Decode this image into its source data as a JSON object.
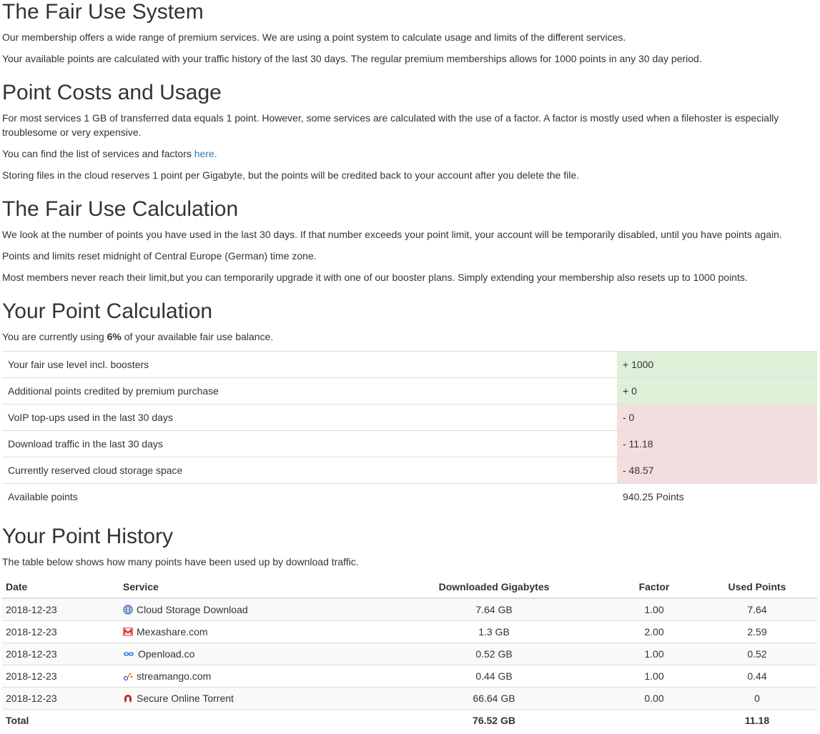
{
  "fair_use": {
    "title": "The Fair Use System",
    "p1": "Our membership offers a wide range of premium services. We are using a point system to calculate usage and limits of the different services.",
    "p2": "Your available points are calculated with your traffic history of the last 30 days. The regular premium memberships allows for 1000 points in any 30 day period."
  },
  "point_costs": {
    "title": "Point Costs and Usage",
    "p1": "For most services 1 GB of transferred data equals 1 point. However, some services are calculated with the use of a factor. A factor is mostly used when a filehoster is especially troublesome or very expensive.",
    "p2_prefix": "You can find the list of services and factors ",
    "p2_link": "here.",
    "p3": "Storing files in the cloud reserves 1 point per Gigabyte, but the points will be credited back to your account after you delete the file."
  },
  "calculation": {
    "title": "The Fair Use Calculation",
    "p1": "We look at the number of points you have used in the last 30 days. If that number exceeds your point limit, your account will be temporarily disabled, until you have points again.",
    "p2": "Points and limits reset midnight of Central Europe (German) time zone.",
    "p3": "Most members never reach their limit,but you can temporarily upgrade it with one of our booster plans. Simply extending your membership also resets up to 1000 points."
  },
  "your_calc": {
    "title": "Your Point Calculation",
    "usage_prefix": "You are currently using ",
    "usage_percent": "6%",
    "usage_suffix": " of your available fair use balance.",
    "rows": [
      {
        "label": "Your fair use level incl. boosters",
        "value": "+ 1000",
        "type": "pos"
      },
      {
        "label": "Additional points credited by premium purchase",
        "value": "+ 0",
        "type": "pos"
      },
      {
        "label": "VoIP top-ups used in the last 30 days",
        "value": "- 0",
        "type": "neg"
      },
      {
        "label": "Download traffic in the last 30 days",
        "value": "- 11.18",
        "type": "neg"
      },
      {
        "label": "Currently reserved cloud storage space",
        "value": "- 48.57",
        "type": "neg"
      },
      {
        "label": "Available points",
        "value": "940.25 Points",
        "type": "plain"
      }
    ]
  },
  "history": {
    "title": "Your Point History",
    "description": "The table below shows how many points have been used up by download traffic.",
    "headers": {
      "date": "Date",
      "service": "Service",
      "downloaded": "Downloaded Gigabytes",
      "factor": "Factor",
      "used": "Used Points"
    },
    "rows": [
      {
        "date": "2018-12-23",
        "service": "Cloud Storage Download",
        "icon": "globe-icon",
        "downloaded": "7.64 GB",
        "factor": "1.00",
        "used": "7.64"
      },
      {
        "date": "2018-12-23",
        "service": "Mexashare.com",
        "icon": "mexashare-icon",
        "downloaded": "1.3 GB",
        "factor": "2.00",
        "used": "2.59"
      },
      {
        "date": "2018-12-23",
        "service": "Openload.co",
        "icon": "infinity-icon",
        "downloaded": "0.52 GB",
        "factor": "1.00",
        "used": "0.52"
      },
      {
        "date": "2018-12-23",
        "service": "streamango.com",
        "icon": "streamango-icon",
        "downloaded": "0.44 GB",
        "factor": "1.00",
        "used": "0.44"
      },
      {
        "date": "2018-12-23",
        "service": "Secure Online Torrent",
        "icon": "magnet-icon",
        "downloaded": "66.64 GB",
        "factor": "0.00",
        "used": "0"
      }
    ],
    "total": {
      "label": "Total",
      "downloaded": "76.52 GB",
      "used": "11.18"
    }
  },
  "colors": {
    "positive_bg": "#dff0d8",
    "negative_bg": "#f2dede",
    "link": "#337ab7",
    "stripe": "#f9f9f9"
  }
}
